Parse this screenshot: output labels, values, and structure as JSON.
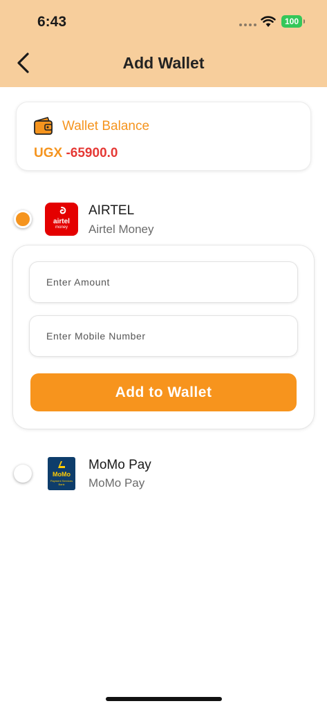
{
  "status_bar": {
    "time": "6:43",
    "battery": "100",
    "battery_color": "#34C759"
  },
  "header": {
    "title": "Add Wallet",
    "back_icon": "chevron-left-icon",
    "background": "#F7CE9C"
  },
  "balance": {
    "label": "Wallet Balance",
    "currency": "UGX",
    "amount": "-65900.0",
    "icon": "wallet-icon",
    "accent_color": "#F5941E",
    "negative_color": "#E53935"
  },
  "options": [
    {
      "name": "AIRTEL",
      "subtitle": "Airtel Money",
      "logo_text": "airtel",
      "logo_subtext": "money",
      "selected": true
    },
    {
      "name": "MoMo Pay",
      "subtitle": "MoMo Pay",
      "logo_text": "MoMo",
      "logo_subtext": "Payment Services Bank",
      "selected": false
    }
  ],
  "form": {
    "amount_placeholder": "Enter Amount",
    "amount_value": "",
    "mobile_placeholder": "Enter Mobile Number",
    "mobile_value": "",
    "submit_label": "Add to Wallet",
    "button_color": "#F7941D"
  }
}
